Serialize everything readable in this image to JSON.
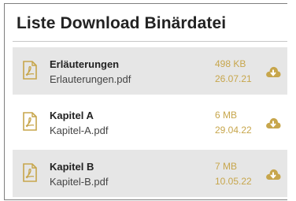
{
  "panel": {
    "title": "Liste Download Binärdatei"
  },
  "files": [
    {
      "title": "Erläuterungen",
      "filename": "Erlauterungen.pdf",
      "size": "498 KB",
      "date": "26.07.21",
      "file_icon": "pdf-file-icon",
      "download_icon": "cloud-download-icon"
    },
    {
      "title": "Kapitel A",
      "filename": "Kapitel-A.pdf",
      "size": "6 MB",
      "date": "29.04.22",
      "file_icon": "pdf-file-icon",
      "download_icon": "cloud-download-icon"
    },
    {
      "title": "Kapitel B",
      "filename": "Kapitel-B.pdf",
      "size": "7 MB",
      "date": "10.05.22",
      "file_icon": "pdf-file-icon",
      "download_icon": "cloud-download-icon"
    }
  ],
  "colors": {
    "accent": "#c7a64c",
    "row_shade": "#e6e6e6",
    "text": "#222222"
  }
}
